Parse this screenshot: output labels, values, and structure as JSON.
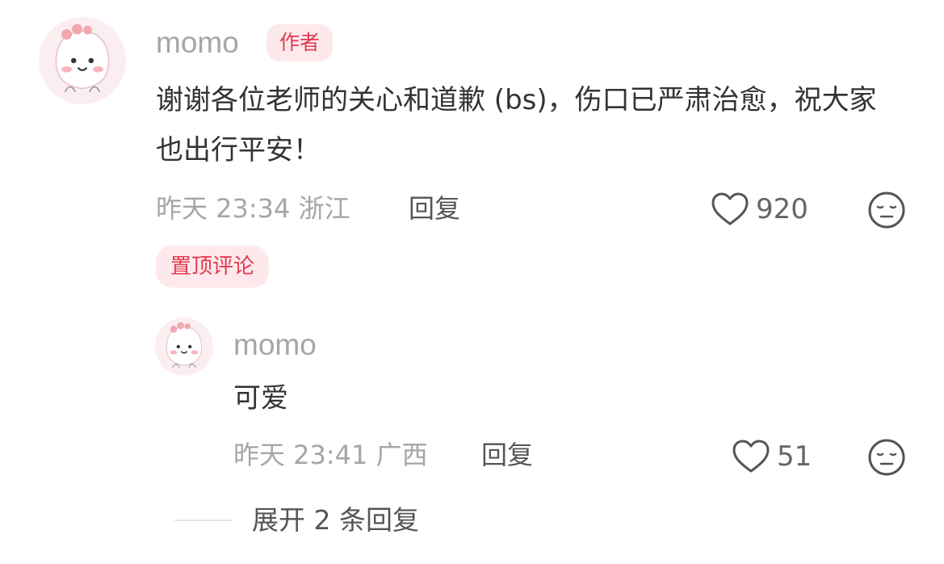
{
  "comment": {
    "username": "momo",
    "author_badge": "作者",
    "content": "谢谢各位老师的关心和道歉 (bs)，伤口已严肃治愈，祝大家也出行平安！",
    "time": "昨天 23:34",
    "location": "浙江",
    "reply_label": "回复",
    "likes": "920",
    "like_icon": "heart-outline-icon",
    "reaction_icon": "neutral-face-icon",
    "pinned_label": "置顶评论",
    "colors": {
      "badge_bg": "#fde9ec",
      "badge_text": "#e23a4f",
      "meta_text": "#a6a6a6"
    }
  },
  "reply": {
    "username": "momo",
    "content": "可爱",
    "time": "昨天 23:41",
    "location": "广西",
    "reply_label": "回复",
    "likes": "51",
    "like_icon": "heart-outline-icon",
    "reaction_icon": "neutral-face-icon"
  },
  "expand": {
    "label": "展开 2 条回复"
  }
}
